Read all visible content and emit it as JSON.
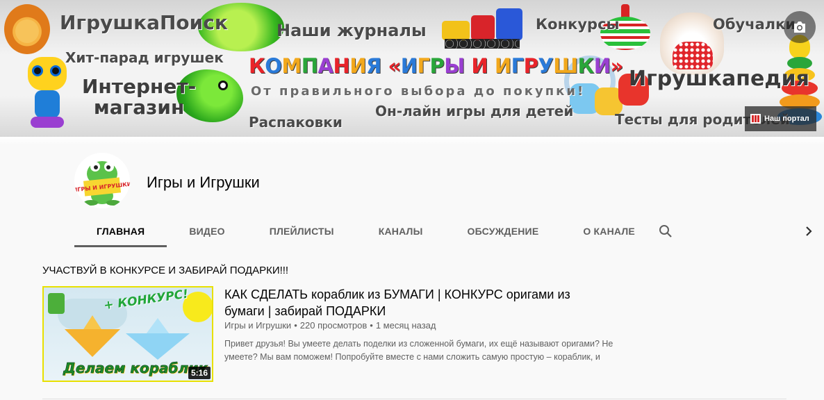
{
  "banner": {
    "search": "ИгрушкаПоиск",
    "journals": "Наши журналы",
    "contests": "Конкурсы",
    "training": "Обучалки",
    "hitparade": "Хит-парад игрушек",
    "shop_line1": "Интернет-",
    "shop_line2": "магазин",
    "company": "КОМПАНИЯ «ИГРЫ И ИГРУШКИ»",
    "slogan": "От правильного выбора до покупки!",
    "wiki": "Игрушкапедия",
    "unboxing": "Распаковки",
    "online_games": "Он-лайн игры для детей",
    "tests": "Тесты для родителей",
    "portal_link": "Наш портал",
    "company_colors": [
      "#e8242a",
      "#2a7ad8",
      "#f2a81c",
      "#2aa63a",
      "#9a3fd1",
      "#e8242a",
      "#f2a81c",
      "#2a7ad8"
    ]
  },
  "channel": {
    "name": "Игры и Игрушки",
    "avatar_text": "ИГРЫ И ИГРУШКИ"
  },
  "tabs": [
    {
      "label": "ГЛАВНАЯ",
      "active": true
    },
    {
      "label": "ВИДЕО",
      "active": false
    },
    {
      "label": "ПЛЕЙЛИСТЫ",
      "active": false
    },
    {
      "label": "КАНАЛЫ",
      "active": false
    },
    {
      "label": "ОБСУЖДЕНИЕ",
      "active": false
    },
    {
      "label": "О КАНАЛЕ",
      "active": false
    }
  ],
  "shelf": {
    "title": "УЧАСТВУЙ В КОНКУРСЕ И ЗАБИРАЙ ПОДАРКИ!!!",
    "video": {
      "thumb_contest": "+ КОНКУРС!",
      "thumb_caption": "Делаем кораблик",
      "duration": "5:16",
      "title": "КАК СДЕЛАТЬ кораблик из БУМАГИ | КОНКУРС оригами из бумаги | забирай ПОДАРКИ",
      "channel": "Игры и Игрушки",
      "views": "220 просмотров",
      "age": "1 месяц назад",
      "separator": "•",
      "description": "Привет друзья! Вы умеете делать поделки из сложенной бумаги, их ещё называют оригами? Не умеете? Мы вам поможем! Попробуйте вместе с нами сложить самую простую – кораблик, и"
    }
  },
  "icons": {
    "camera": "camera-icon",
    "search": "search-icon",
    "next": "chevron-right-icon",
    "portal": "portal-icon"
  }
}
